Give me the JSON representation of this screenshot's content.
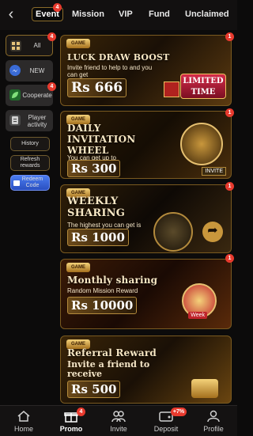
{
  "tabs": [
    {
      "label": "Event",
      "badge": "4",
      "active": true
    },
    {
      "label": "Mission"
    },
    {
      "label": "VIP"
    },
    {
      "label": "Fund"
    },
    {
      "label": "Unclaimed"
    }
  ],
  "sidebar": {
    "items": [
      {
        "label": "All",
        "badge": "4",
        "icon": "grid-icon",
        "active": true
      },
      {
        "label": "NEW",
        "icon": "messenger-icon"
      },
      {
        "label": "Cooperate",
        "badge": "4",
        "icon": "leaf-icon"
      },
      {
        "label": "Player activity",
        "icon": "clipboard-icon"
      }
    ],
    "small_items": [
      {
        "label": "History"
      },
      {
        "label": "Refresh rewards"
      },
      {
        "label": "Redeem Code"
      }
    ]
  },
  "banners": [
    {
      "logo": "GAME",
      "title": "LUCK DRAW BOOST",
      "subtitle": "Invite friend to help to and you can get",
      "amount": "Rs 666",
      "tag": "LIMITED TIME",
      "badge": "1"
    },
    {
      "logo": "GAME",
      "title": "DAILY INVITATION WHEEL",
      "subtitle": "You can get up to",
      "amount": "Rs 300",
      "tag": "INVITE",
      "badge": "1"
    },
    {
      "logo": "GAME",
      "title": "WEEKLY SHARING",
      "subtitle": "The highest you can get is",
      "amount": "Rs 1000",
      "badge": "1"
    },
    {
      "logo": "GAME",
      "title": "Monthly sharing",
      "subtitle": "Random Mission Reward",
      "amount": "Rs 10000",
      "tag": "Week",
      "badge": "1"
    },
    {
      "logo": "GAME",
      "title": "Referral Reward",
      "subtitle": "Invite a friend to receive",
      "amount": "Rs 500"
    }
  ],
  "bottom_nav": [
    {
      "label": "Home",
      "icon": "home-icon"
    },
    {
      "label": "Promo",
      "icon": "gift-icon",
      "badge": "4",
      "active": true
    },
    {
      "label": "Invite",
      "icon": "users-icon"
    },
    {
      "label": "Deposit",
      "icon": "wallet-icon",
      "badge": "+7%"
    },
    {
      "label": "Profile",
      "icon": "profile-icon"
    }
  ],
  "colors": {
    "accent": "#e83a2e",
    "gold": "#b38a3c",
    "background": "#0c0b0b"
  }
}
